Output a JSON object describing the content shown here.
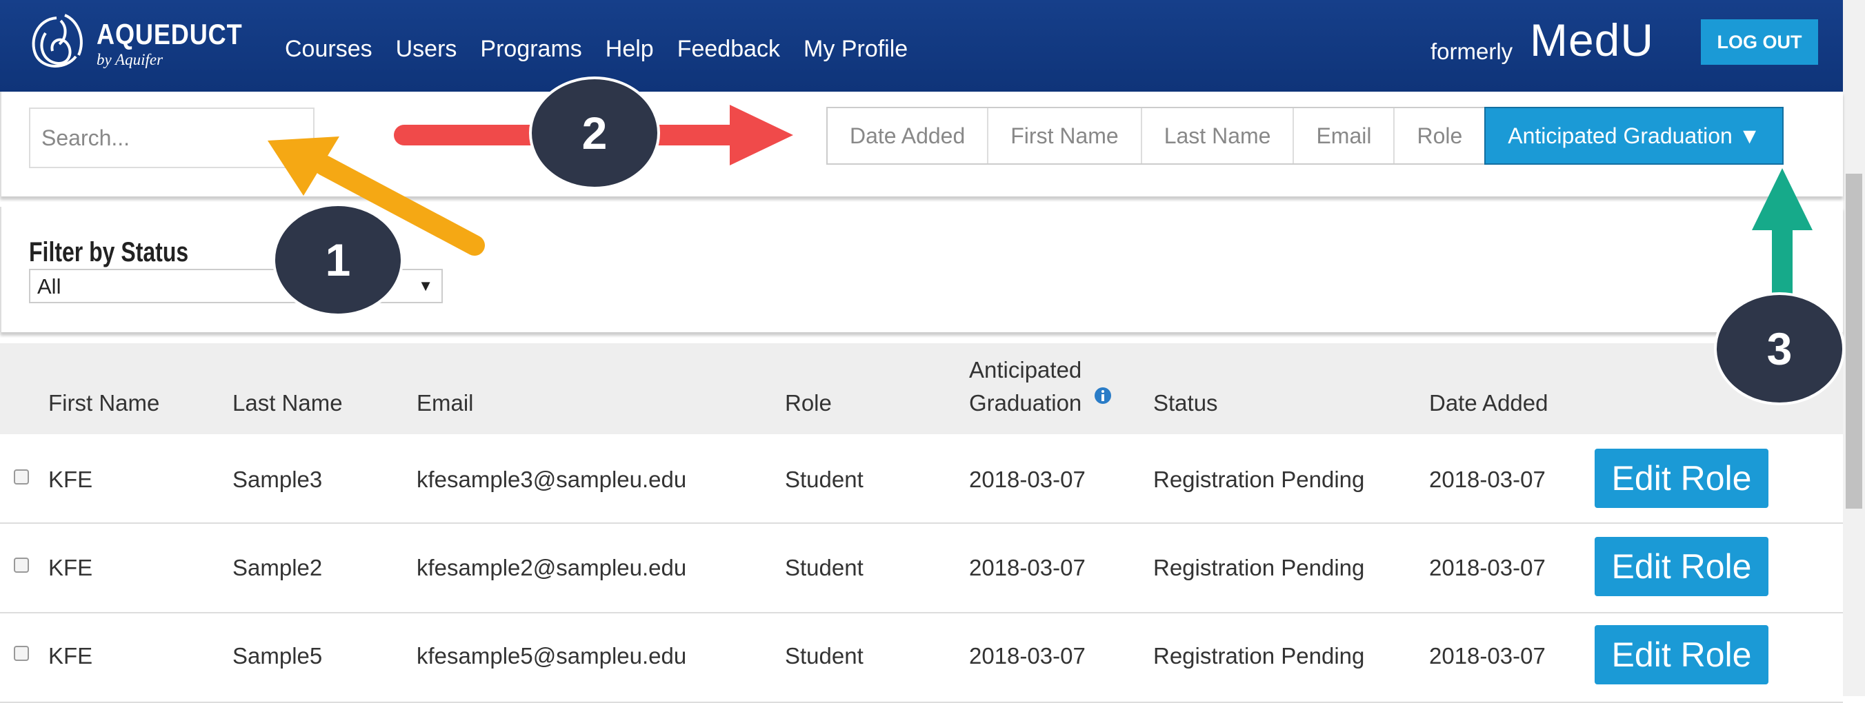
{
  "header": {
    "brand_name": "AQUEDUCT",
    "brand_sub": "by Aquifer",
    "nav": [
      "Courses",
      "Users",
      "Programs",
      "Help",
      "Feedback",
      "My Profile"
    ],
    "formerly_label": "formerly",
    "former_brand": "MedU",
    "logout_label": "LOG OUT"
  },
  "search": {
    "placeholder": "Search..."
  },
  "sort": {
    "options": [
      "Date Added",
      "First Name",
      "Last Name",
      "Email",
      "Role",
      "Anticipated Graduation ▼"
    ],
    "active": "Anticipated Graduation"
  },
  "filter": {
    "label": "Filter by Status",
    "selected": "All"
  },
  "table": {
    "headers": {
      "first_name": "First Name",
      "last_name": "Last Name",
      "email": "Email",
      "role": "Role",
      "grad_line1": "Anticipated",
      "grad_line2": "Graduation",
      "status": "Status",
      "date_added": "Date Added"
    },
    "rows": [
      {
        "first": "KFE",
        "last": "Sample3",
        "email": "kfesample3@sampleu.edu",
        "role": "Student",
        "grad": "2018-03-07",
        "status": "Registration Pending",
        "added": "2018-03-07",
        "action": "Edit Role"
      },
      {
        "first": "KFE",
        "last": "Sample2",
        "email": "kfesample2@sampleu.edu",
        "role": "Student",
        "grad": "2018-03-07",
        "status": "Registration Pending",
        "added": "2018-03-07",
        "action": "Edit Role"
      },
      {
        "first": "KFE",
        "last": "Sample5",
        "email": "kfesample5@sampleu.edu",
        "role": "Student",
        "grad": "2018-03-07",
        "status": "Registration Pending",
        "added": "2018-03-07",
        "action": "Edit Role"
      }
    ]
  },
  "annotations": {
    "badges": [
      "1",
      "2",
      "3"
    ]
  },
  "colors": {
    "header_bg": "#163f8a",
    "accent": "#1b9ad6",
    "arrow_yellow": "#f5a814",
    "arrow_red": "#f04a4a",
    "arrow_green": "#16aa8a",
    "badge_bg": "#2e3649"
  }
}
